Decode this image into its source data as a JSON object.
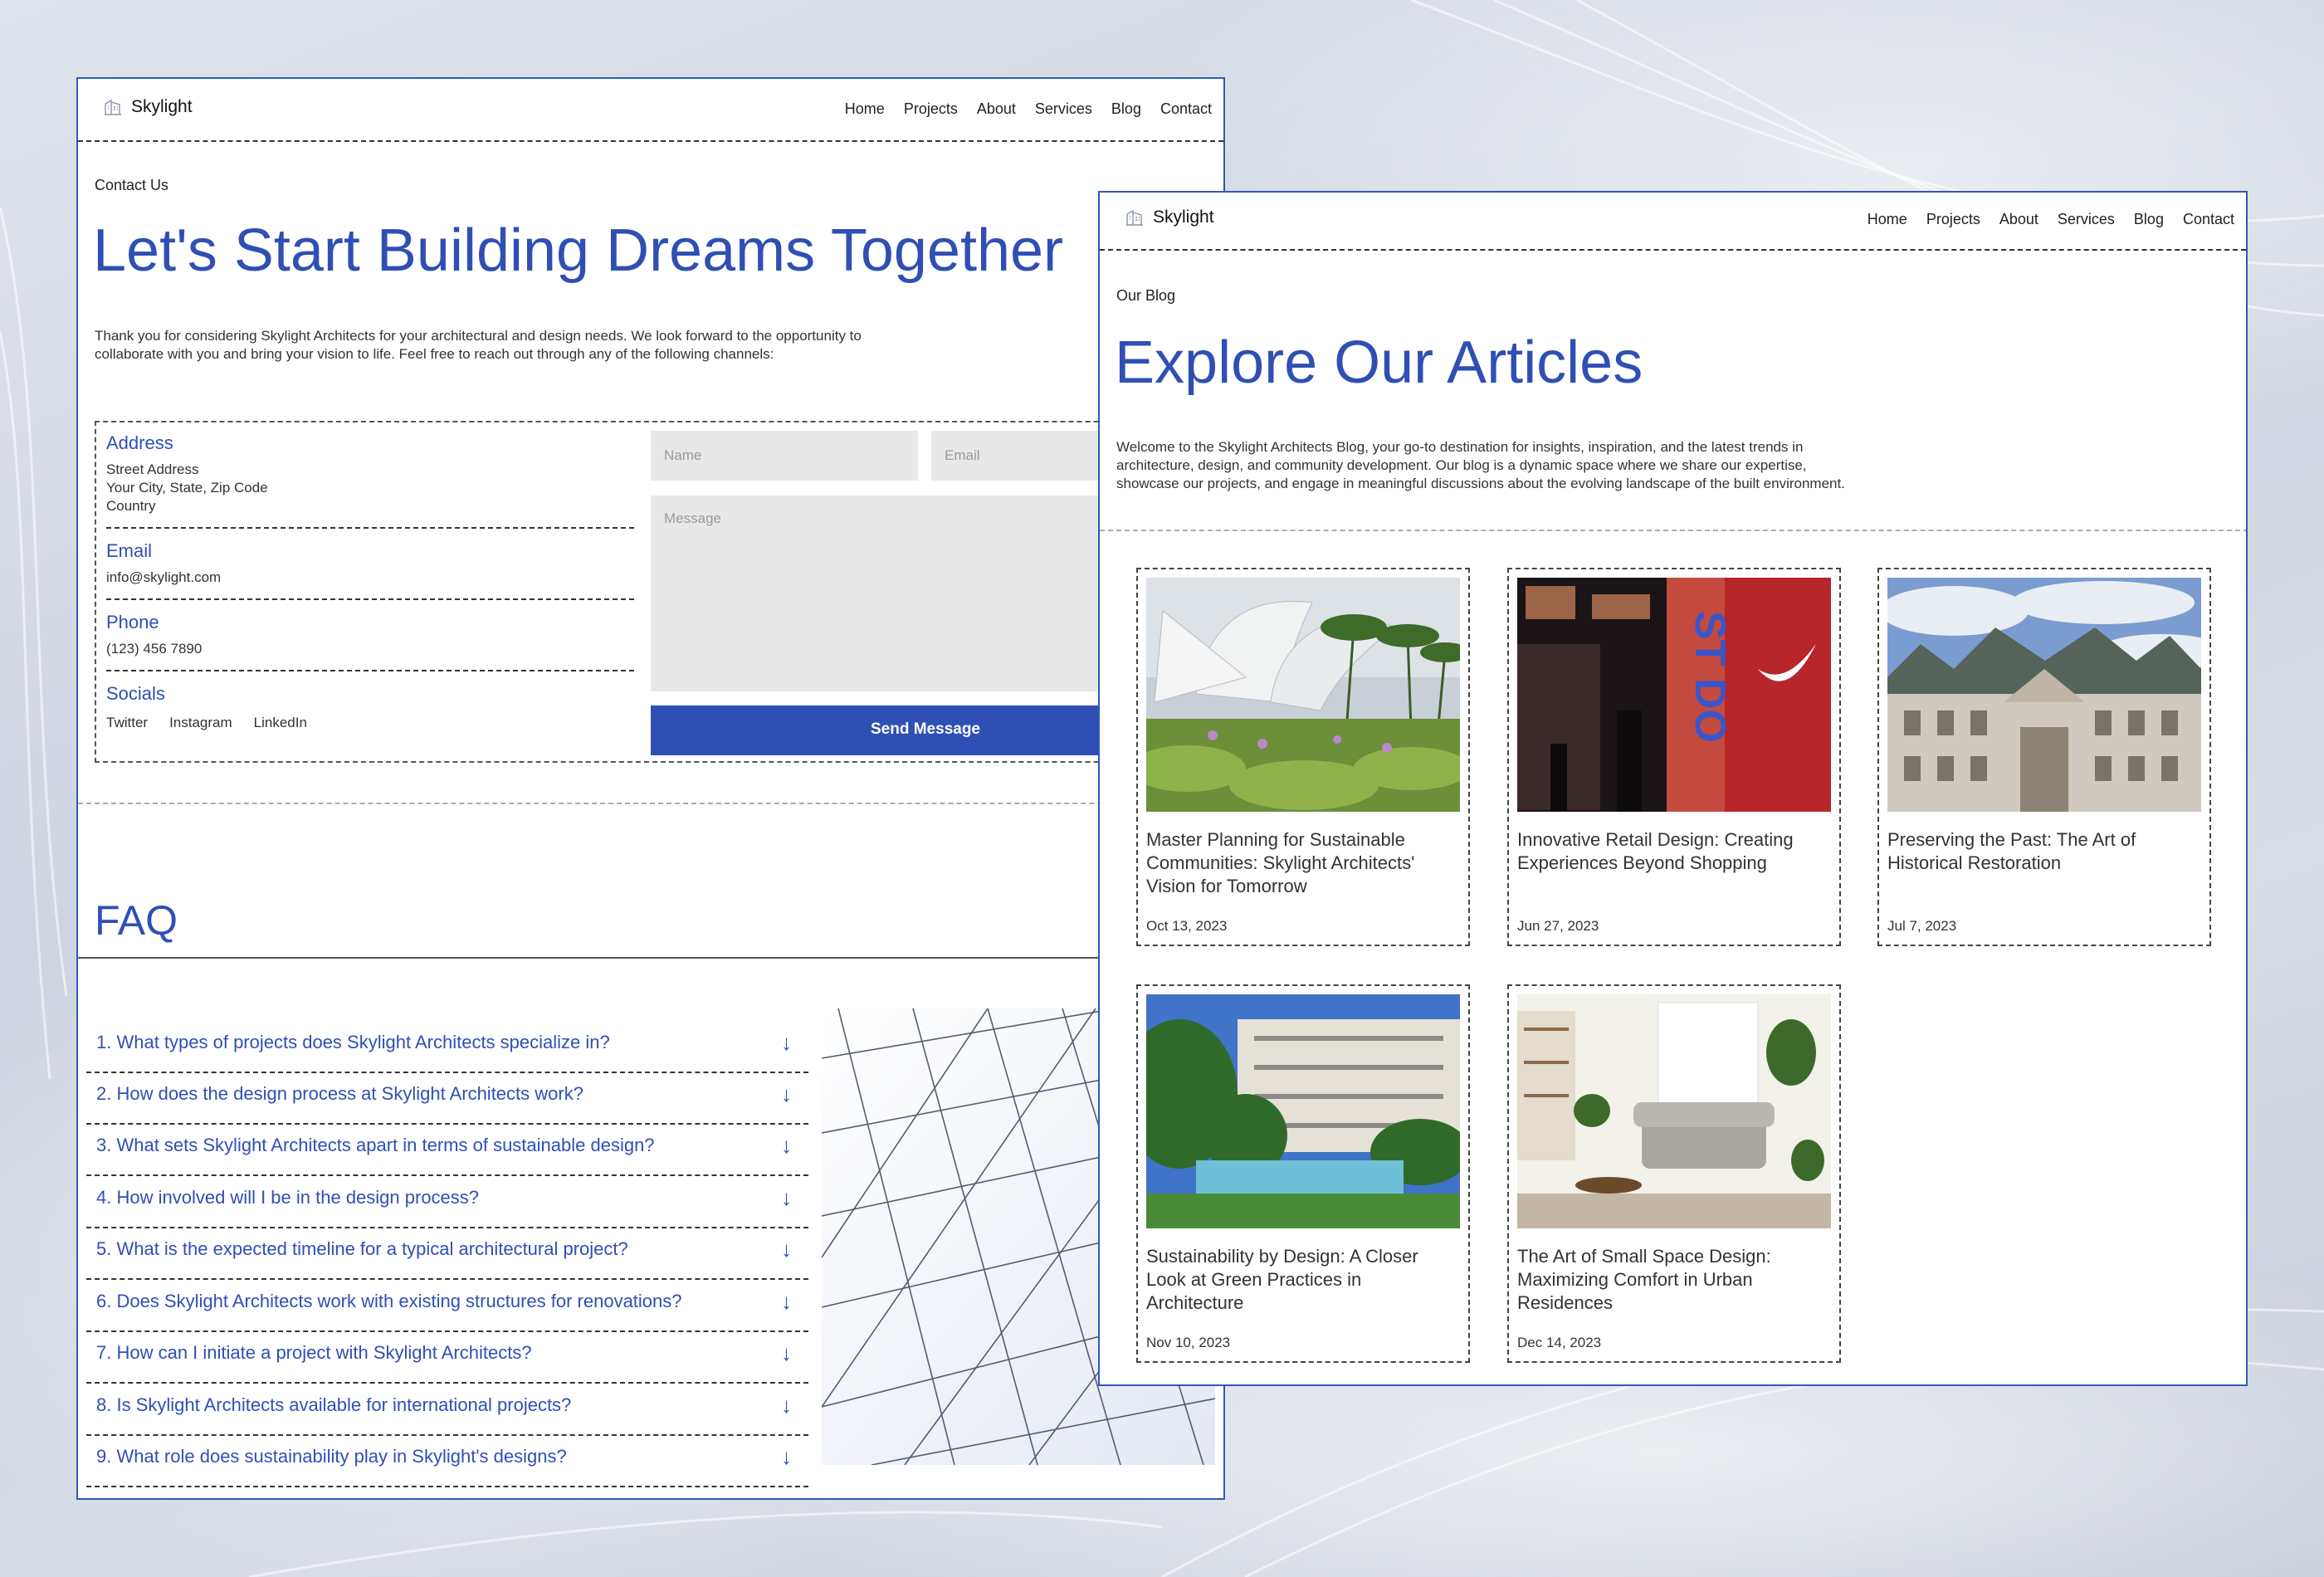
{
  "brand": {
    "name": "Skylight",
    "accent": "#2f4fb5"
  },
  "nav": [
    "Home",
    "Projects",
    "About",
    "Services",
    "Blog",
    "Contact"
  ],
  "contact_page": {
    "eyebrow": "Contact Us",
    "title": "Let's Start Building Dreams Together",
    "intro": "Thank you for considering Skylight Architects for your architectural and design needs. We look forward to the opportunity to collaborate with you and bring your vision to life. Feel free to reach out through any of the following channels:",
    "address": {
      "label": "Address",
      "line1": "Street Address",
      "line2": "Your City, State, Zip Code",
      "line3": "Country"
    },
    "email": {
      "label": "Email",
      "value": "info@skylight.com"
    },
    "phone": {
      "label": "Phone",
      "value": "(123) 456 7890"
    },
    "socials": {
      "label": "Socials",
      "items": [
        "Twitter",
        "Instagram",
        "LinkedIn"
      ]
    },
    "form": {
      "name_placeholder": "Name",
      "email_placeholder": "Email",
      "message_placeholder": "Message",
      "submit": "Send Message"
    },
    "faq": {
      "title": "FAQ",
      "questions": [
        "1. What types of projects does Skylight Architects specialize in?",
        "2. How does the design process at Skylight Architects work?",
        "3. What sets Skylight Architects apart in terms of sustainable design?",
        "4. How involved will I be in the design process?",
        "5. What is the expected timeline for a typical architectural project?",
        "6. Does Skylight Architects work with existing structures for renovations?",
        "7. How can I initiate a project with Skylight Architects?",
        "8. Is Skylight Architects available for international projects?",
        "9. What role does sustainability play in Skylight's designs?"
      ]
    }
  },
  "blog_page": {
    "eyebrow": "Our Blog",
    "title": "Explore Our Articles",
    "intro": "Welcome to the Skylight Architects Blog, your go-to destination for insights, inspiration, and the latest trends in architecture, design, and community development. Our blog is a dynamic space where we share our expertise, showcase our projects, and engage in meaningful discussions about the evolving landscape of the built environment.",
    "articles": [
      {
        "title": "Master Planning for Sustainable Communities: Skylight Architects' Vision for Tomorrow",
        "date": "Oct 13, 2023"
      },
      {
        "title": "Innovative Retail Design: Creating Experiences Beyond Shopping",
        "date": "Jun 27, 2023"
      },
      {
        "title": "Preserving the Past: The Art of Historical Restoration",
        "date": "Jul 7, 2023"
      },
      {
        "title": "Sustainability by Design: A Closer Look at Green Practices in Architecture",
        "date": "Nov 10, 2023"
      },
      {
        "title": "The Art of Small Space Design: Maximizing Comfort in Urban Residences",
        "date": "Dec 14, 2023"
      }
    ]
  }
}
